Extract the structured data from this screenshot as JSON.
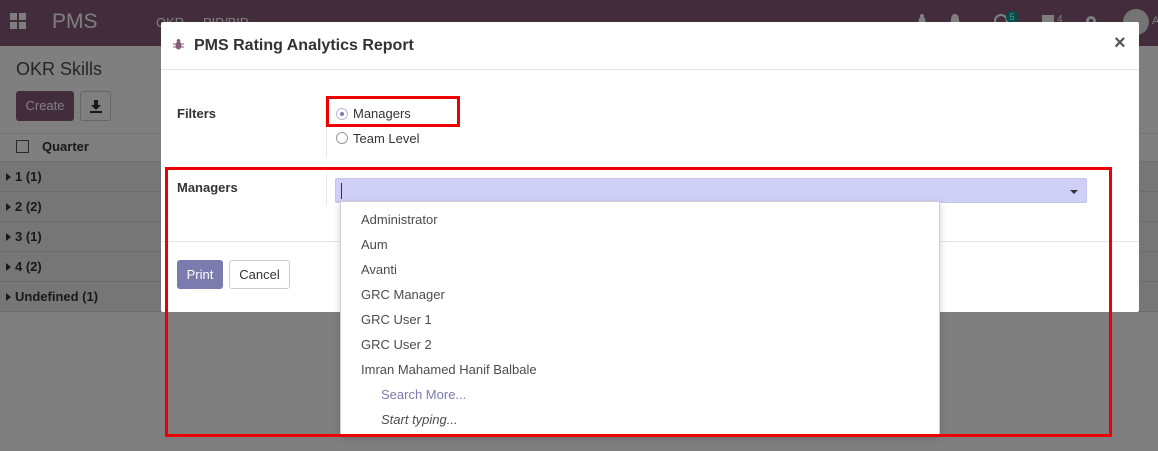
{
  "app": {
    "brand": "PMS",
    "menu": [
      "OKR",
      "PIP/BIP"
    ],
    "messages_count": "4",
    "activity_count": "5",
    "user_initial": "A"
  },
  "control_panel": {
    "title": "OKR Skills",
    "create_label": "Create"
  },
  "list": {
    "column_quarter": "Quarter",
    "groups": [
      "1 (1)",
      "2 (2)",
      "3 (1)",
      "4 (2)",
      "Undefined (1)"
    ]
  },
  "modal": {
    "title": "PMS Rating Analytics Report",
    "close_glyph": "×",
    "filters_label": "Filters",
    "filter_options": [
      {
        "label": "Managers",
        "checked": true
      },
      {
        "label": "Team Level",
        "checked": false
      }
    ],
    "managers_label": "Managers",
    "managers_value": "",
    "print_label": "Print",
    "cancel_label": "Cancel"
  },
  "dropdown": {
    "items": [
      "Administrator",
      "Aum",
      "Avanti",
      "GRC Manager",
      "GRC User 1",
      "GRC User 2",
      "Imran Mahamed Hanif Balbale"
    ],
    "search_more": "Search More...",
    "start_typing": "Start typing..."
  },
  "colors": {
    "primary": "#875a7b",
    "accent": "#7c7bad",
    "annotation": "#ee0000",
    "select_bg": "#cfcff7"
  }
}
